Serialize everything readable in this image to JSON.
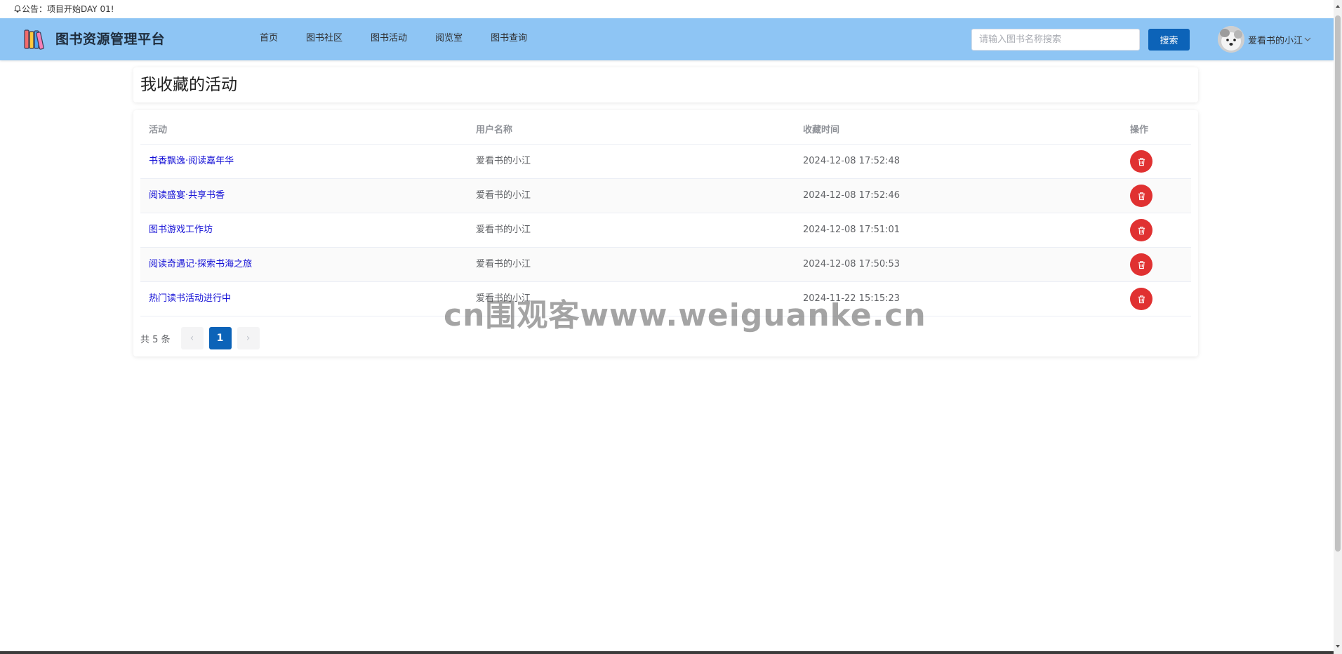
{
  "notice": {
    "text": "公告：项目开始DAY 01!"
  },
  "header": {
    "site_title": "图书资源管理平台",
    "nav": [
      "首页",
      "图书社区",
      "图书活动",
      "阅览室",
      "图书查询"
    ],
    "search_placeholder": "请输入图书名称搜索",
    "search_value": "",
    "search_button": "搜索",
    "user_name": "爱看书的小江",
    "colors": {
      "header_bg": "#8ec5f4",
      "primary": "#0c63b8",
      "danger": "#e03131",
      "link": "#1410d6"
    }
  },
  "page": {
    "title": "我收藏的活动"
  },
  "table": {
    "headers": [
      "活动",
      "用户名称",
      "收藏时间",
      "操作"
    ],
    "rows": [
      {
        "activity": "书香飘逸·阅读嘉年华",
        "user": "爱看书的小江",
        "time": "2024-12-08 17:52:48",
        "action_icon": "trash-icon"
      },
      {
        "activity": "阅读盛宴·共享书香",
        "user": "爱看书的小江",
        "time": "2024-12-08 17:52:46",
        "action_icon": "trash-icon"
      },
      {
        "activity": "图书游戏工作坊",
        "user": "爱看书的小江",
        "time": "2024-12-08 17:51:01",
        "action_icon": "trash-icon"
      },
      {
        "activity": "阅读奇遇记·探索书海之旅",
        "user": "爱看书的小江",
        "time": "2024-12-08 17:50:53",
        "action_icon": "trash-icon"
      },
      {
        "activity": "热门读书活动进行中",
        "user": "爱看书的小江",
        "time": "2024-11-22 15:15:23",
        "action_icon": "trash-icon"
      }
    ]
  },
  "pagination": {
    "total_text": "共 5 条",
    "prev": "‹",
    "current_page": "1",
    "next": "›"
  },
  "watermark": {
    "text": "cn围观客www.weiguanke.cn"
  }
}
